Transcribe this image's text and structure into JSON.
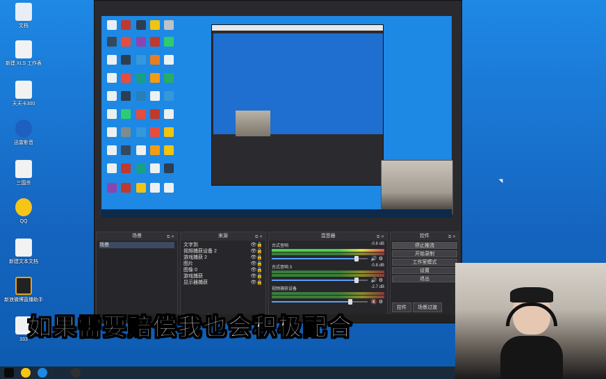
{
  "desktop": {
    "icons": [
      {
        "label": "文档"
      },
      {
        "label": "新建 XLS 工作表"
      },
      {
        "label": "天天卡300"
      },
      {
        "label": "迅雷影音"
      },
      {
        "label": "三国杀"
      },
      {
        "label": "QQ"
      },
      {
        "label": "新建文本文档"
      },
      {
        "label": "新浪微博直播助手"
      },
      {
        "label": "333"
      }
    ]
  },
  "obs": {
    "docks": {
      "scenes": {
        "title": "场景",
        "items": [
          "场景"
        ],
        "footer": "+ − ∧ ∨"
      },
      "sources": {
        "title": "来源",
        "items": [
          "文字到",
          "视频捕获设备 2",
          "游戏捕获 2",
          "图片",
          "图像 0",
          "游戏捕获",
          "显示器捕获"
        ],
        "footer": "+ − ⚙ ∧ ∨"
      },
      "mixer": {
        "title": "混音器",
        "channels": [
          {
            "name": "台式音响",
            "db": "-0.8 dB"
          },
          {
            "name": "台式音响 3",
            "db": "-0.8 dB"
          },
          {
            "name": "视频捕获设备",
            "db": "-2.7 dB"
          }
        ]
      },
      "controls": {
        "title": "控件",
        "buttons": [
          "停止推流",
          "开始录制",
          "工作室模式",
          "设置",
          "退出"
        ]
      }
    },
    "tabs": [
      "控件",
      "场景过渡"
    ]
  },
  "subtitle": "如果需要赔偿我也会积极配合",
  "colors": {
    "desktop": "#1e88e5",
    "obs_bg": "#2a2a2e",
    "subtitle": "#ffffff"
  }
}
